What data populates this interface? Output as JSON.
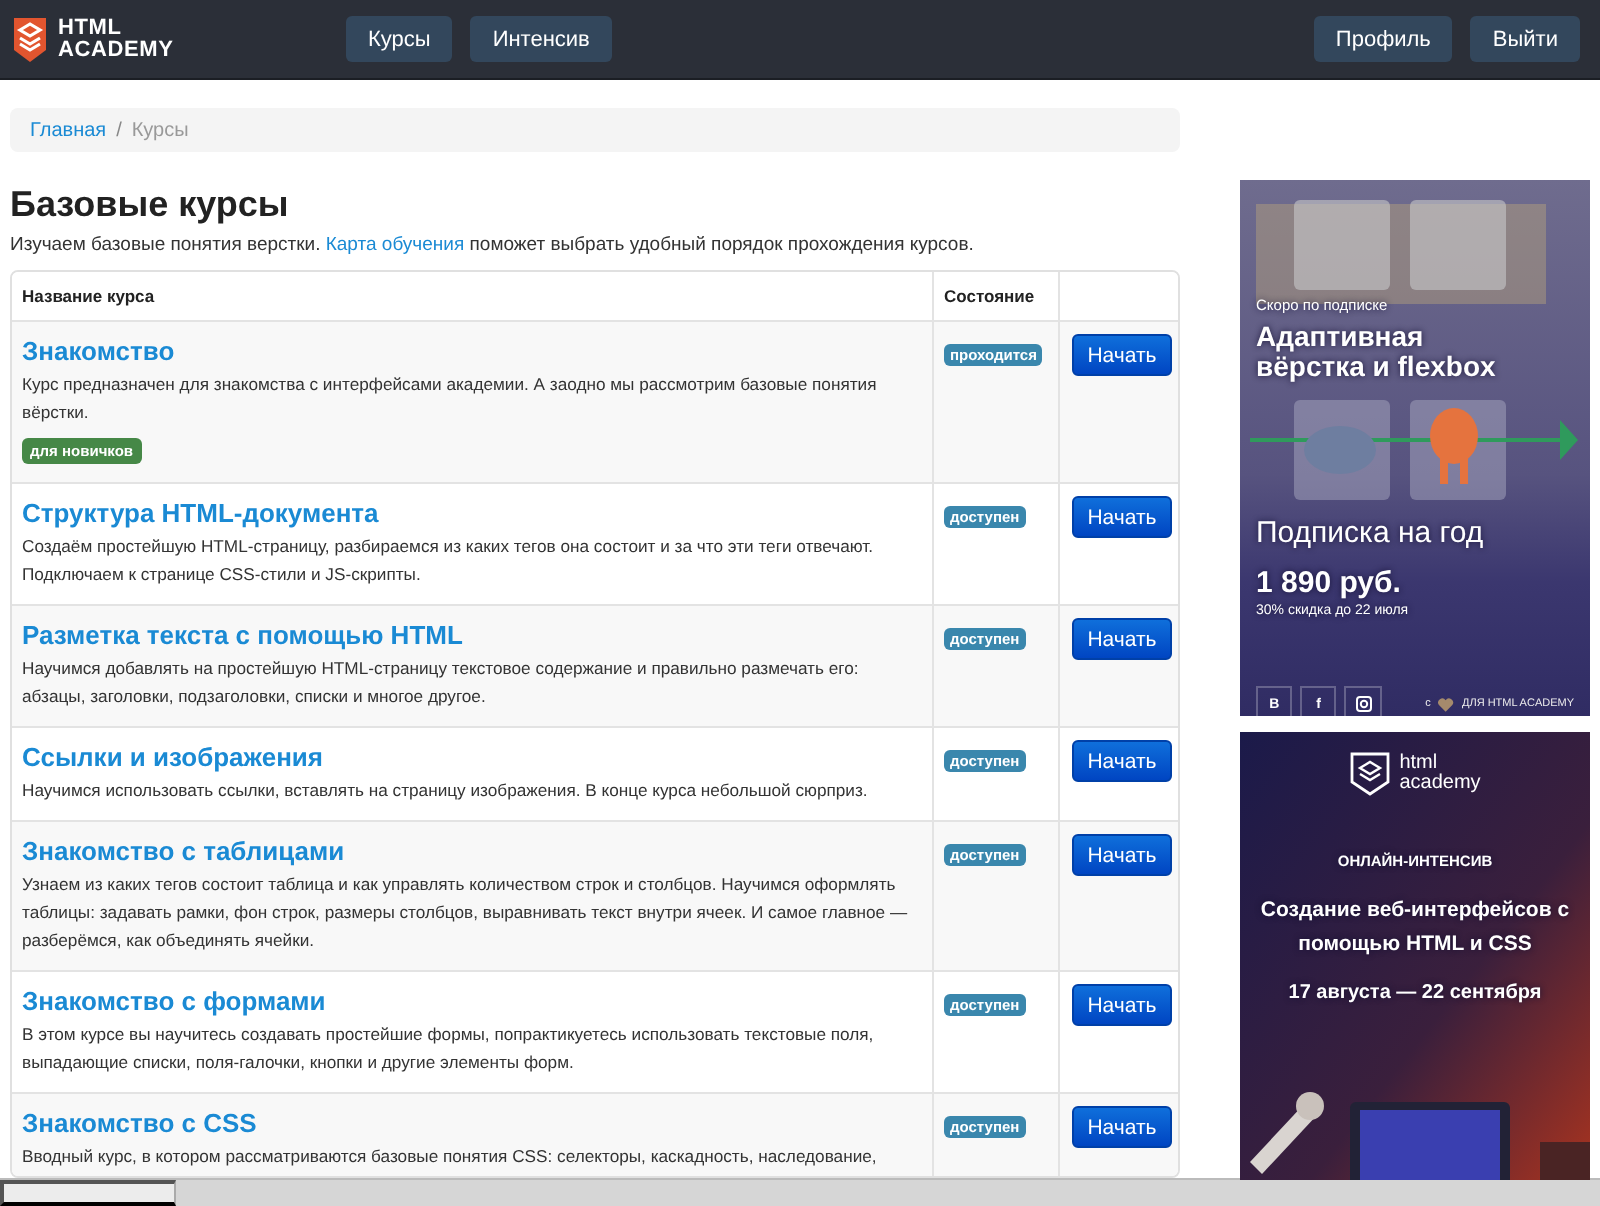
{
  "header": {
    "logo": [
      "HTML",
      "ACADEMY"
    ],
    "nav": [
      {
        "label": "Курсы"
      },
      {
        "label": "Интенсив"
      }
    ],
    "account": [
      {
        "label": "Профиль"
      },
      {
        "label": "Выйти"
      }
    ]
  },
  "breadcrumb_separator": "/",
  "breadcrumb": [
    {
      "label": "Главная",
      "kind": "link"
    },
    {
      "label": "Курсы",
      "kind": "current"
    }
  ],
  "page": {
    "title": "Базовые курсы",
    "intro_before": "Изучаем базовые понятия верстки.",
    "intro_link": "Карта обучения",
    "intro_after": "поможет выбрать удобный порядок прохождения курсов."
  },
  "table": {
    "columns": [
      "Название курса",
      "Состояние"
    ],
    "rows": [
      {
        "title": "Знакомство",
        "description": "Курс предназначен для знакомства с интерфейсами академии. А заодно мы рассмотрим базовые понятия вёрстки.",
        "tags": [
          "для новичков"
        ],
        "status": "проходится",
        "action": "Начать"
      },
      {
        "title": "Структура HTML-документа",
        "description": "Создаём простейшую HTML-страницу, разбираемся из каких тегов она состоит и за что эти теги отвечают. Подключаем к странице CSS-стили и JS-скрипты.",
        "status": "доступен",
        "action": "Начать"
      },
      {
        "title": "Разметка текста с помощью HTML",
        "description": "Научимся добавлять на простейшую HTML-страницу текстовое содержание и правильно размечать его: абзацы, заголовки, подзаголовки, списки и многое другое.",
        "status": "доступен",
        "action": "Начать"
      },
      {
        "title": "Ссылки и изображения",
        "description": "Научимся использовать ссылки, вставлять на страницу изображения. В конце курса небольшой сюрприз.",
        "status": "доступен",
        "action": "Начать"
      },
      {
        "title": "Знакомство с таблицами",
        "description": "Узнаем из каких тегов состоит таблица и как управлять количеством строк и столбцов. Научимся оформлять таблицы: задавать рамки, фон строк, размеры столбцов, выравнивать текст внутри ячеек. И самое главное — разберёмся, как объединять ячейки.",
        "status": "доступен",
        "action": "Начать"
      },
      {
        "title": "Знакомство с формами",
        "description": "В этом курсе вы научитесь создавать простейшие формы, попрактикуетесь использовать текстовые поля, выпадающие списки, поля-галочки, кнопки и другие элементы форм.",
        "status": "доступен",
        "action": "Начать"
      },
      {
        "title": "Знакомство с CSS",
        "description": "Вводный курс, в котором рассматриваются базовые понятия CSS: селекторы, каскадность, наследование,",
        "status": "доступен",
        "action": "Начать"
      }
    ]
  },
  "ads": [
    {
      "kind": "subscription",
      "eyebrow": "Скоро по подписке",
      "headline": "Адаптивная вёрстка и flexbox",
      "offer": "Подписка на год",
      "price": "1 890 руб.",
      "note": "30% скидка до 22 июля",
      "social": [
        "В",
        "f"
      ],
      "credit_prefix": "с",
      "credit": "ДЛЯ HTML ACADEMY"
    },
    {
      "kind": "intensive",
      "logo": [
        "html",
        "academy"
      ],
      "eyebrow": "ОНЛАЙН-ИНТЕНСИВ",
      "headline": "Создание веб-интерфейсов с помощью HTML и CSS",
      "dates": "17 августа — 22 сентября"
    }
  ]
}
